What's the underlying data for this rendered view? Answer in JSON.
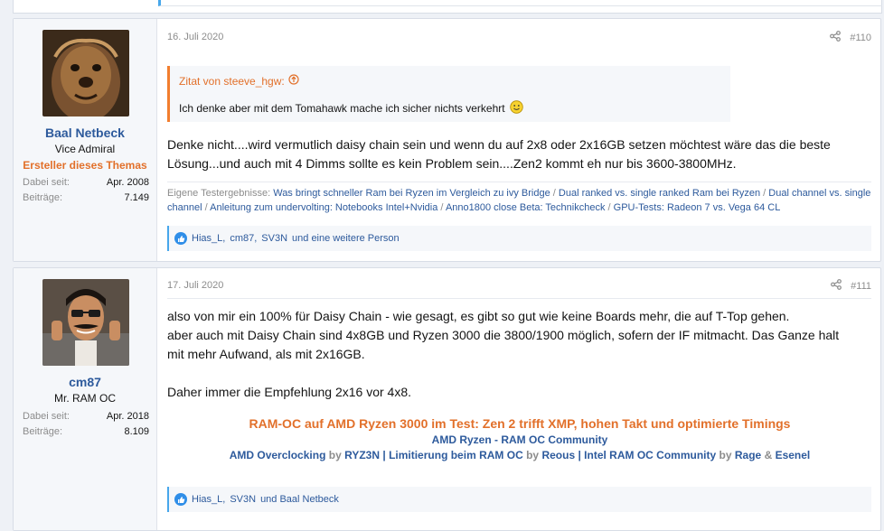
{
  "posts": [
    {
      "user": {
        "name": "Baal Netbeck",
        "title": "Vice Admiral",
        "starter": "Ersteller dieses Themas",
        "stats": [
          {
            "label": "Dabei seit:",
            "value": "Apr. 2008"
          },
          {
            "label": "Beiträge:",
            "value": "7.149"
          }
        ]
      },
      "date": "16. Juli 2020",
      "number": "#110",
      "quote": {
        "author": "Zitat von steeve_hgw:",
        "text": "Ich denke aber mit dem Tomahawk mache ich sicher nichts verkehrt"
      },
      "body": [
        "Denke nicht....wird vermutlich daisy chain sein und wenn du auf 2x8 oder 2x16GB setzen möchtest wäre das die beste",
        "Lösung...und auch mit 4 Dimms sollte es kein Problem sein....Zen2 kommt eh nur bis 3600-3800MHz."
      ],
      "signature": {
        "prefix": "Eigene Testergebnisse:",
        "links": [
          "Was bringt schneller Ram bei Ryzen im Vergleich zu ivy Bridge",
          "Dual ranked vs. single ranked Ram bei Ryzen",
          "Dual channel vs. single channel",
          "Anleitung zum undervolting: Notebooks Intel+Nvidia",
          "Anno1800 close Beta: Technikcheck",
          "GPU-Tests: Radeon 7 vs. Vega 64 CL"
        ],
        "separator": "/"
      },
      "reactions": {
        "names": [
          "Hias_L",
          "cm87",
          "SV3N"
        ],
        "suffix": "und eine weitere Person"
      }
    },
    {
      "user": {
        "name": "cm87",
        "title": "Mr. RAM OC",
        "stats": [
          {
            "label": "Dabei seit:",
            "value": "Apr. 2018"
          },
          {
            "label": "Beiträge:",
            "value": "8.109"
          }
        ]
      },
      "date": "17. Juli 2020",
      "number": "#111",
      "body": [
        "also von mir ein 100% für Daisy Chain - wie gesagt, es gibt so gut wie keine Boards mehr, die auf T-Top gehen.",
        "aber auch mit Daisy Chain sind 4x8GB und Ryzen 3000 die 3800/1900 möglich, sofern der IF mitmacht. Das Ganze halt",
        "mit mehr Aufwand, als mit 2x16GB.",
        "",
        "Daher immer die Empfehlung 2x16 vor 4x8."
      ],
      "signature": {
        "headline": "RAM-OC auf AMD Ryzen 3000 im Test: Zen 2 trifft XMP, hohen Takt und optimierte Timings",
        "line2": "AMD Ryzen - RAM OC Community",
        "line3": {
          "a1": "AMD Overclocking",
          "by1": "by",
          "a2": "RYZ3N",
          "sep1": "|",
          "a3": "Limitierung beim RAM OC",
          "by2": "by",
          "a4": "Reous",
          "sep2": "|",
          "a5": "Intel RAM OC Community",
          "by3": "by",
          "a6": "Rage",
          "amp": "&",
          "a7": "Esenel"
        }
      },
      "reactions": {
        "names": [
          "Hias_L",
          "SV3N"
        ],
        "suffix": "und Baal Netbeck"
      }
    }
  ],
  "colors": {
    "accent": "#2d5a9c",
    "orange": "#e2702a",
    "quote_border": "#f27e2e",
    "link_blue": "#47a7eb"
  },
  "icons": {
    "share": "share-icon",
    "quote_arrow": "arrow-up-circle-icon",
    "like": "like-icon",
    "smiley": "smiley-icon"
  }
}
